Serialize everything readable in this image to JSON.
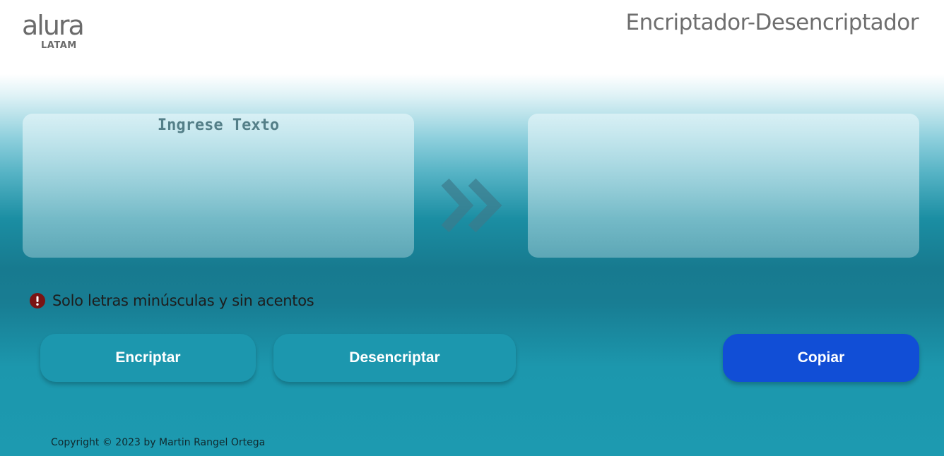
{
  "header": {
    "logo_word": "alura",
    "logo_sub": "LATAM",
    "title": "Encriptador-Desencriptador"
  },
  "input_panel": {
    "placeholder": "Ingrese Texto",
    "value": ""
  },
  "output_panel": {
    "value": ""
  },
  "arrow": {
    "icon": "double-chevron-right-icon",
    "color": "#3c7b8b"
  },
  "warning": {
    "icon": "exclamation-circle-icon",
    "text": "Solo letras minúsculas y sin acentos",
    "icon_color": "#7a1414"
  },
  "buttons": {
    "encrypt_label": "Encriptar",
    "decrypt_label": "Desencriptar",
    "copy_label": "Copiar"
  },
  "colors": {
    "primary_button": "#1c97ae",
    "copy_button": "#114ed6",
    "background_teal": "#1b8ea3"
  },
  "footer": {
    "text": "Copyright © 2023 by Martin Rangel Ortega"
  }
}
